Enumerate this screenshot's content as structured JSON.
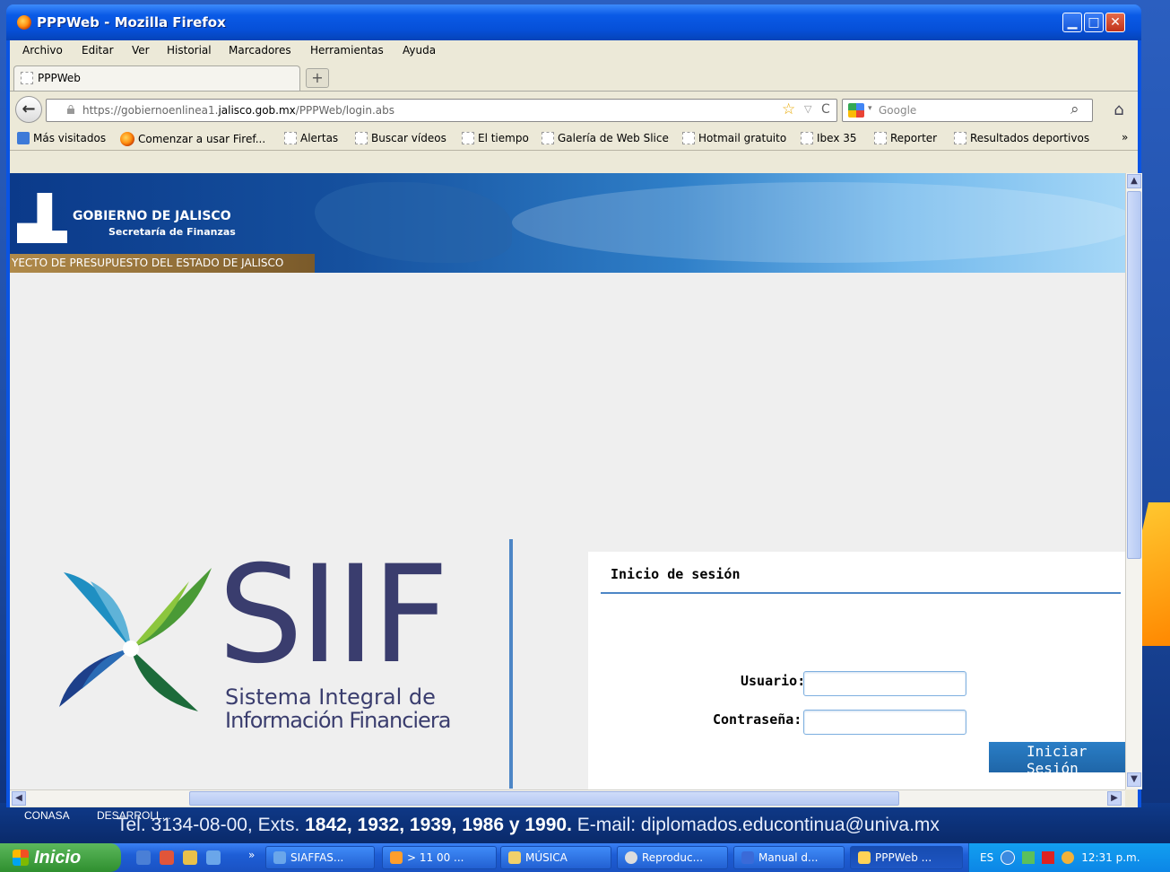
{
  "window": {
    "title": "PPPWeb - Mozilla Firefox",
    "min": "▁",
    "max": "□",
    "close": "✕"
  },
  "menu": [
    "Archivo",
    "Editar",
    "Ver",
    "Historial",
    "Marcadores",
    "Herramientas",
    "Ayuda"
  ],
  "tab": {
    "label": "PPPWeb",
    "new_tab": "+"
  },
  "nav": {
    "back": "←",
    "url_prefix": "https://gobiernoenlinea1.",
    "url_domain": "jalisco.gob.mx",
    "url_suffix": "/PPPWeb/login.abs",
    "star": "☆",
    "dropdown": "▽",
    "reload": "C",
    "search_placeholder": "Google",
    "search_icon": "⌕",
    "home": "⌂"
  },
  "bookmarks": [
    "Más visitados",
    "Comenzar a usar Firef...",
    "Alertas",
    "Buscar vídeos",
    "El tiempo",
    "Galería de Web Slice",
    "Hotmail gratuito",
    "Ibex 35",
    "Reporter",
    "Resultados deportivos"
  ],
  "bookmarks_more": "»",
  "banner": {
    "title": "GOBIERNO DE JALISCO",
    "subtitle": "Secretaría de Finanzas",
    "strip": "YECTO DE PRESUPUESTO DEL ESTADO DE JALISCO"
  },
  "logo": {
    "big": "SIIF",
    "line1": "Sistema Integral de",
    "line2": "Información Financiera"
  },
  "login": {
    "title": "Inicio de sesión",
    "user_label": "Usuario:",
    "user_value": "",
    "password_label": "Contraseña:",
    "password_value": "",
    "button": "Iniciar Sesión"
  },
  "scroll": {
    "up": "▲",
    "down": "▼",
    "left": "◀",
    "right": "▶"
  },
  "desktop": {
    "icons": [
      "CONASA",
      "DESARROLL..."
    ],
    "wallpaper_text_a": "Tel. 3134-08-00, Exts. ",
    "wallpaper_text_b": "1842, 1932, 1939, 1986 y 1990.",
    "wallpaper_text_c": " E-mail: diplomados.educontinua@univa.mx"
  },
  "taskbar": {
    "start": "Inicio",
    "chevron": "»",
    "tasks": [
      "SIAFFAS...",
      "> 11 00 ...",
      "MÚSICA",
      "Reproduc...",
      "Manual d...",
      "PPPWeb ..."
    ],
    "lang": "ES",
    "time": "12:31 p.m."
  },
  "colors": {
    "accent": "#4d86c6",
    "title_blue": "#0a54e3",
    "login_button": "#1f66a8"
  }
}
